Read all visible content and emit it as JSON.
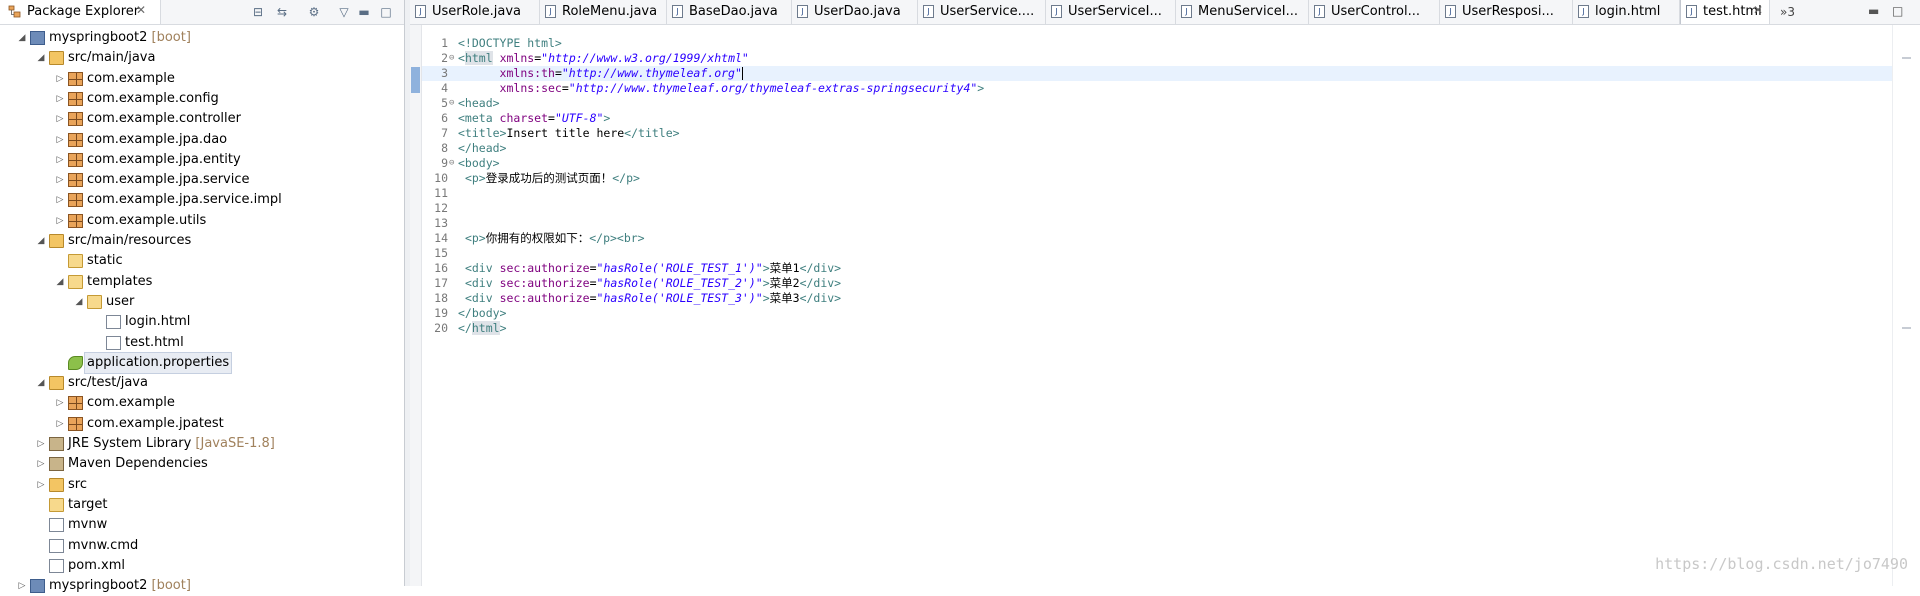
{
  "package_explorer": {
    "title": "Package Explorer",
    "tree": [
      {
        "label": "myspringboot2",
        "decoration": "[boot]",
        "icon": "project-icon",
        "twisty": "expanded",
        "depth": 0
      },
      {
        "label": "src/main/java",
        "icon": "source-folder-icon",
        "twisty": "expanded",
        "depth": 1
      },
      {
        "label": "com.example",
        "icon": "package-icon",
        "twisty": "collapsed",
        "depth": 2
      },
      {
        "label": "com.example.config",
        "icon": "package-icon",
        "twisty": "collapsed",
        "depth": 2
      },
      {
        "label": "com.example.controller",
        "icon": "package-icon",
        "twisty": "collapsed",
        "depth": 2
      },
      {
        "label": "com.example.jpa.dao",
        "icon": "package-icon",
        "twisty": "collapsed",
        "depth": 2
      },
      {
        "label": "com.example.jpa.entity",
        "icon": "package-icon",
        "twisty": "collapsed",
        "depth": 2
      },
      {
        "label": "com.example.jpa.service",
        "icon": "package-icon",
        "twisty": "collapsed",
        "depth": 2
      },
      {
        "label": "com.example.jpa.service.impl",
        "icon": "package-icon",
        "twisty": "collapsed",
        "depth": 2
      },
      {
        "label": "com.example.utils",
        "icon": "package-icon",
        "twisty": "collapsed",
        "depth": 2
      },
      {
        "label": "src/main/resources",
        "icon": "source-folder-icon",
        "twisty": "expanded",
        "depth": 1
      },
      {
        "label": "static",
        "icon": "folder-icon",
        "twisty": "none",
        "depth": 2
      },
      {
        "label": "templates",
        "icon": "folder-icon",
        "twisty": "expanded",
        "depth": 2
      },
      {
        "label": "user",
        "icon": "folder-icon",
        "twisty": "expanded",
        "depth": 3
      },
      {
        "label": "login.html",
        "icon": "html-file-icon",
        "twisty": "none",
        "depth": 4
      },
      {
        "label": "test.html",
        "icon": "html-file-icon",
        "twisty": "none",
        "depth": 4
      },
      {
        "label": "application.properties",
        "icon": "properties-file-icon",
        "twisty": "none",
        "depth": 2,
        "selected": true
      },
      {
        "label": "src/test/java",
        "icon": "source-folder-icon",
        "twisty": "expanded",
        "depth": 1
      },
      {
        "label": "com.example",
        "icon": "package-icon",
        "twisty": "collapsed",
        "depth": 2
      },
      {
        "label": "com.example.jpatest",
        "icon": "package-icon",
        "twisty": "collapsed",
        "depth": 2
      },
      {
        "label": "JRE System Library",
        "decoration": "[JavaSE-1.8]",
        "icon": "library-icon",
        "twisty": "collapsed",
        "depth": 1
      },
      {
        "label": "Maven Dependencies",
        "icon": "library-icon",
        "twisty": "collapsed",
        "depth": 1
      },
      {
        "label": "src",
        "icon": "source-folder-icon",
        "twisty": "collapsed",
        "depth": 1
      },
      {
        "label": "target",
        "icon": "folder-icon",
        "twisty": "none",
        "depth": 1
      },
      {
        "label": "mvnw",
        "icon": "file-icon",
        "twisty": "none",
        "depth": 1
      },
      {
        "label": "mvnw.cmd",
        "icon": "file-icon",
        "twisty": "none",
        "depth": 1
      },
      {
        "label": "pom.xml",
        "icon": "xml-file-icon",
        "twisty": "none",
        "depth": 1
      },
      {
        "label": "myspringboot2",
        "decoration": "[boot]",
        "icon": "project-icon",
        "twisty": "collapsed",
        "depth": 0
      }
    ]
  },
  "editor": {
    "tabs": [
      {
        "label": "UserRole.java",
        "active": false
      },
      {
        "label": "RoleMenu.java",
        "active": false
      },
      {
        "label": "BaseDao.java",
        "active": false
      },
      {
        "label": "UserDao.java",
        "active": false
      },
      {
        "label": "UserService....",
        "active": false
      },
      {
        "label": "UserServiceI...",
        "active": false
      },
      {
        "label": "MenuServiceI...",
        "active": false
      },
      {
        "label": "UserControl...",
        "active": false
      },
      {
        "label": "UserResposi...",
        "active": false
      },
      {
        "label": "login.html",
        "active": false
      },
      {
        "label": "test.html",
        "active": true
      }
    ],
    "overflow_label": "»3",
    "current_line": 3,
    "lines": [
      {
        "n": "1",
        "fold": "",
        "segs": [
          [
            "doc",
            "<!DOCTYPE html>"
          ]
        ]
      },
      {
        "n": "2",
        "fold": "⊖",
        "segs": [
          [
            "tag",
            "<"
          ],
          [
            "tagh",
            "html"
          ],
          [
            "txt",
            " "
          ],
          [
            "attr",
            "xmlns"
          ],
          [
            "txt",
            "="
          ],
          [
            "val",
            "\"http://www.w3.org/1999/xhtml\""
          ]
        ]
      },
      {
        "n": "3",
        "fold": "",
        "segs": [
          [
            "txt",
            "      "
          ],
          [
            "attr",
            "xmlns:th"
          ],
          [
            "txt",
            "="
          ],
          [
            "val",
            "\"http://www.thymeleaf.org\""
          ],
          [
            "cursor",
            ""
          ]
        ]
      },
      {
        "n": "4",
        "fold": "",
        "segs": [
          [
            "txt",
            "      "
          ],
          [
            "attr",
            "xmlns:sec"
          ],
          [
            "txt",
            "="
          ],
          [
            "val",
            "\"http://www.thymeleaf.org/thymeleaf-extras-springsecurity4\""
          ],
          [
            "tag",
            ">"
          ]
        ]
      },
      {
        "n": "5",
        "fold": "⊖",
        "segs": [
          [
            "tag",
            "<head>"
          ]
        ]
      },
      {
        "n": "6",
        "fold": "",
        "segs": [
          [
            "tag",
            "<meta "
          ],
          [
            "attr",
            "charset"
          ],
          [
            "txt",
            "="
          ],
          [
            "val",
            "\"UTF-8\""
          ],
          [
            "tag",
            ">"
          ]
        ]
      },
      {
        "n": "7",
        "fold": "",
        "segs": [
          [
            "tag",
            "<title>"
          ],
          [
            "txt",
            "Insert title here"
          ],
          [
            "tag",
            "</title>"
          ]
        ]
      },
      {
        "n": "8",
        "fold": "",
        "segs": [
          [
            "tag",
            "</head>"
          ]
        ]
      },
      {
        "n": "9",
        "fold": "⊖",
        "segs": [
          [
            "tag",
            "<body>"
          ]
        ]
      },
      {
        "n": "10",
        "fold": "",
        "segs": [
          [
            "txt",
            " "
          ],
          [
            "tag",
            "<p>"
          ],
          [
            "txt",
            "登录成功后的测试页面！"
          ],
          [
            "tag",
            "</p>"
          ]
        ]
      },
      {
        "n": "11",
        "fold": "",
        "segs": []
      },
      {
        "n": "12",
        "fold": "",
        "segs": []
      },
      {
        "n": "13",
        "fold": "",
        "segs": []
      },
      {
        "n": "14",
        "fold": "",
        "segs": [
          [
            "txt",
            " "
          ],
          [
            "tag",
            "<p>"
          ],
          [
            "txt",
            "你拥有的权限如下："
          ],
          [
            "tag",
            "</p><br>"
          ]
        ]
      },
      {
        "n": "15",
        "fold": "",
        "segs": []
      },
      {
        "n": "16",
        "fold": "",
        "segs": [
          [
            "txt",
            " "
          ],
          [
            "tag",
            "<div "
          ],
          [
            "attr",
            "sec:authorize"
          ],
          [
            "txt",
            "="
          ],
          [
            "val",
            "\"hasRole('ROLE_TEST_1')\""
          ],
          [
            "tag",
            ">"
          ],
          [
            "txt",
            "菜单1"
          ],
          [
            "tag",
            "</div>"
          ]
        ]
      },
      {
        "n": "17",
        "fold": "",
        "segs": [
          [
            "txt",
            " "
          ],
          [
            "tag",
            "<div "
          ],
          [
            "attr",
            "sec:authorize"
          ],
          [
            "txt",
            "="
          ],
          [
            "val",
            "\"hasRole('ROLE_TEST_2')\""
          ],
          [
            "tag",
            ">"
          ],
          [
            "txt",
            "菜单2"
          ],
          [
            "tag",
            "</div>"
          ]
        ]
      },
      {
        "n": "18",
        "fold": "",
        "segs": [
          [
            "txt",
            " "
          ],
          [
            "tag",
            "<div "
          ],
          [
            "attr",
            "sec:authorize"
          ],
          [
            "txt",
            "="
          ],
          [
            "val",
            "\"hasRole('ROLE_TEST_3')\""
          ],
          [
            "tag",
            ">"
          ],
          [
            "txt",
            "菜单3"
          ],
          [
            "tag",
            "</div>"
          ]
        ]
      },
      {
        "n": "19",
        "fold": "",
        "segs": [
          [
            "tag",
            "</body>"
          ]
        ]
      },
      {
        "n": "20",
        "fold": "",
        "segs": [
          [
            "tag",
            "</"
          ],
          [
            "tagh",
            "html"
          ],
          [
            "tag",
            ">"
          ]
        ]
      }
    ]
  },
  "watermark": "https://blog.csdn.net/jo7490"
}
